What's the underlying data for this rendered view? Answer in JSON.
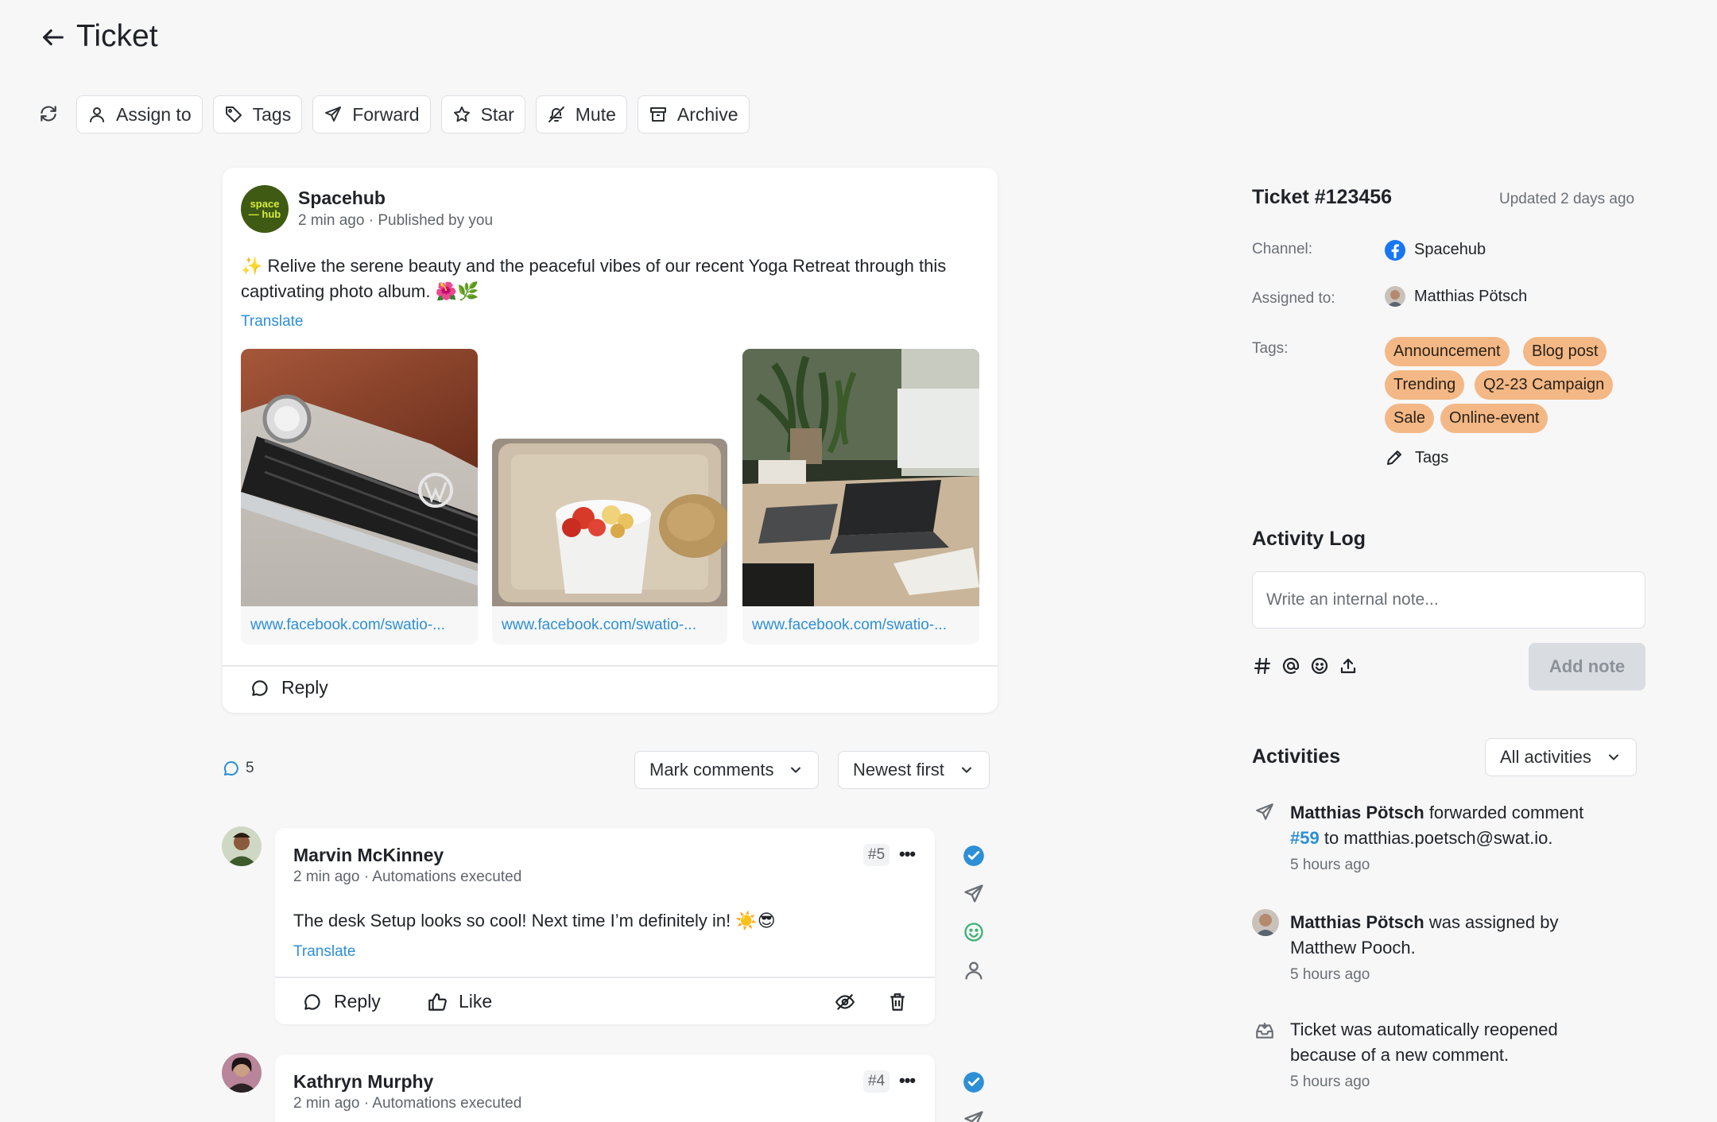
{
  "header": {
    "title": "Ticket"
  },
  "toolbar": {
    "assign": "Assign to",
    "tags": "Tags",
    "forward": "Forward",
    "star": "Star",
    "mute": "Mute",
    "archive": "Archive"
  },
  "post": {
    "avatar_text_1": "space",
    "avatar_text_2": "— hub",
    "author": "Spacehub",
    "meta": "2 min ago · Published by you",
    "text": "Relive the serene beauty and the peaceful vibes of our recent Yoga Retreat through this captivating photo album.",
    "emoji_suffix": "🌺🌿",
    "sparkle": "✨",
    "translate": "Translate",
    "images": [
      {
        "link": "www.facebook.com/swatio-..."
      },
      {
        "link": "www.facebook.com/swatio-..."
      },
      {
        "link": "www.facebook.com/swatio-..."
      }
    ],
    "reply": "Reply"
  },
  "comments_header": {
    "count": "5",
    "mark_comments": "Mark comments",
    "sort": "Newest first"
  },
  "comments": [
    {
      "name": "Marvin McKinney",
      "meta": "2 min ago · Automations executed",
      "number": "#5",
      "text": "The desk Setup looks so cool! Next time I’m definitely in! ☀️😎",
      "translate": "Translate",
      "reply": "Reply",
      "like": "Like"
    },
    {
      "name": "Kathryn Murphy",
      "meta": "2 min ago · Automations executed",
      "number": "#4"
    }
  ],
  "ticket": {
    "title": "Ticket #123456",
    "updated": "Updated 2 days ago",
    "channel_label": "Channel:",
    "channel_value": "Spacehub",
    "assigned_label": "Assigned to:",
    "assigned_value": "Matthias Pötsch",
    "tags_label": "Tags:",
    "tags": [
      "Announcement",
      "Blog post",
      "Trending",
      "Q2-23 Campaign",
      "Sale",
      "Online-event"
    ],
    "edit_tags": "Tags",
    "tag_color": "#f3b885"
  },
  "activity_log": {
    "title": "Activity Log",
    "placeholder": "Write an internal note...",
    "add_note": "Add note"
  },
  "activities": {
    "title": "Activities",
    "filter": "All activities",
    "items": [
      {
        "actor": "Matthias Pötsch",
        "action": " forwarded comment",
        "link": "#59",
        "rest": " to matthias.poetsch@swat.io.",
        "time": "5 hours ago"
      },
      {
        "actor": "Matthias Pötsch",
        "action": " was assigned by Matthew Pooch.",
        "time": "5 hours ago"
      },
      {
        "text": "Ticket was automatically reopened because of a new comment.",
        "time": "5 hours ago"
      }
    ]
  },
  "colors": {
    "link": "#2d8fd6",
    "check": "#2d8fd6",
    "emoji_green": "#3bb273",
    "facebook": "#1877f2"
  }
}
